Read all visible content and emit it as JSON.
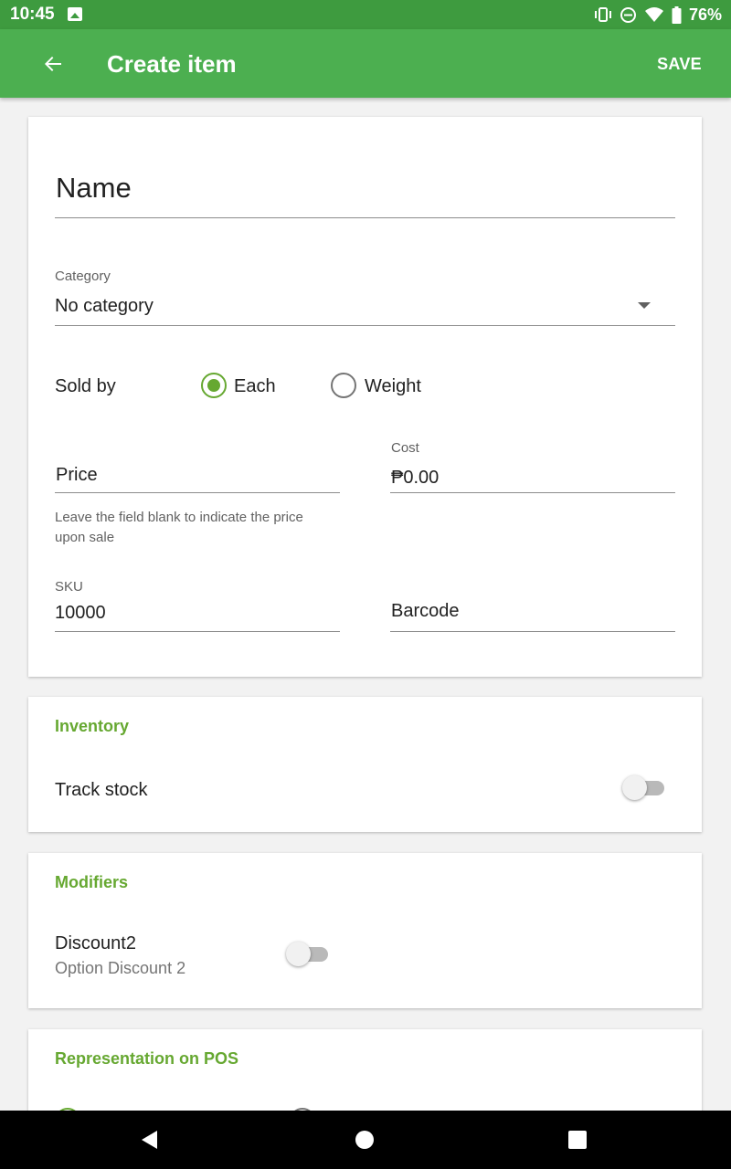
{
  "status_bar": {
    "time": "10:45",
    "battery": "76%",
    "icons": [
      "image-icon",
      "vibrate-icon",
      "do-not-disturb-icon",
      "wifi-icon",
      "battery-icon"
    ]
  },
  "app_bar": {
    "title": "Create item",
    "save_label": "SAVE",
    "back_icon": "arrow-back-icon",
    "background": "#4caf50"
  },
  "form": {
    "name_placeholder": "Name",
    "category_label": "Category",
    "category_value": "No category",
    "sold_by_label": "Sold by",
    "sold_by_options": [
      {
        "label": "Each",
        "checked": true
      },
      {
        "label": "Weight",
        "checked": false
      }
    ],
    "price_placeholder": "Price",
    "price_hint": "Leave the field blank to indicate the price upon sale",
    "cost_label": "Cost",
    "cost_value": "₱0.00",
    "sku_label": "SKU",
    "sku_value": "10000",
    "barcode_placeholder": "Barcode"
  },
  "inventory": {
    "title": "Inventory",
    "track_stock_label": "Track stock",
    "track_stock_on": false
  },
  "modifiers": {
    "title": "Modifiers",
    "items": [
      {
        "name": "Discount2",
        "options": "Option Discount 2",
        "enabled": false
      }
    ]
  },
  "representation": {
    "title": "Representation on POS"
  },
  "colors": {
    "accent": "#66a831",
    "status_bar": "#3e9b3f"
  }
}
